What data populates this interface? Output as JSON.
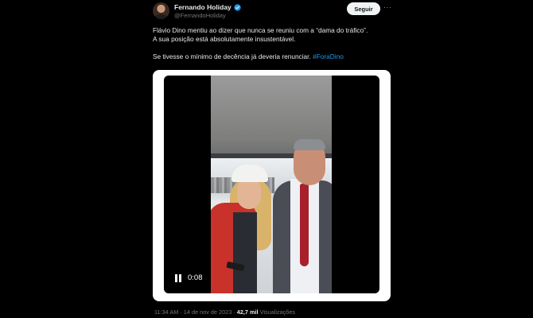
{
  "author": {
    "display_name": "Fernando Holiday",
    "handle": "@FernandoHoliday",
    "verified": true
  },
  "follow_label": "Seguir",
  "more_label": "···",
  "tweet": {
    "line1": "Flávio Dino mentiu ao dizer que nunca se reuniu com a “dama do tráfico”.",
    "line2": "A sua posição está absolutamente insustentável.",
    "line3": "Se tivesse o mínimo de decência já deveria renunciar.",
    "hashtag": "#ForaDino"
  },
  "video": {
    "time": "0:08",
    "state": "playing"
  },
  "meta": {
    "time": "11:34 AM",
    "separator": " · ",
    "date": "14 de nov de 2023",
    "views_count": "42,7 mil",
    "views_label": "Visualizações"
  },
  "colors": {
    "background": "#000000",
    "text": "#e7e9ea",
    "muted": "#71767b",
    "link": "#1d9bf0",
    "verified_badge": "#1d9bf0"
  }
}
